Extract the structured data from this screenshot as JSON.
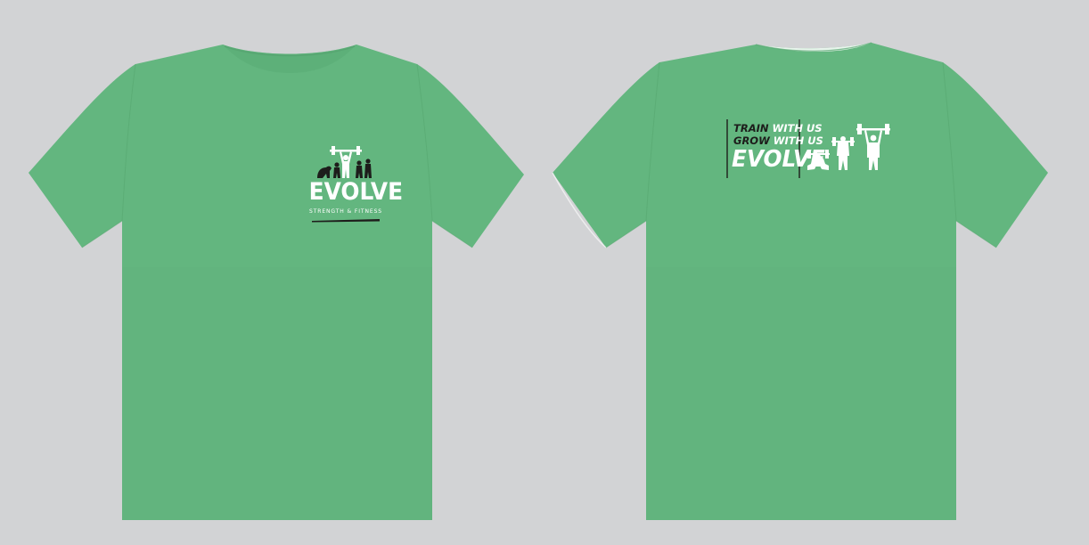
{
  "colors": {
    "background": "#d2d3d5",
    "shirt": "#63b67f",
    "logo_white": "#ffffff",
    "logo_dark": "#1d1d1b"
  },
  "front": {
    "logo_icon": "evolution-lifters-icon",
    "brand": "EVOLVE",
    "tagline": "STRENGTH & FITNESS"
  },
  "back": {
    "line1_a": "TRAIN",
    "line1_b": "WITH US",
    "line2_a": "GROW",
    "line2_b": "WITH US",
    "brand": "EVOLVE",
    "figures_icon": "weightlifters-icon"
  }
}
